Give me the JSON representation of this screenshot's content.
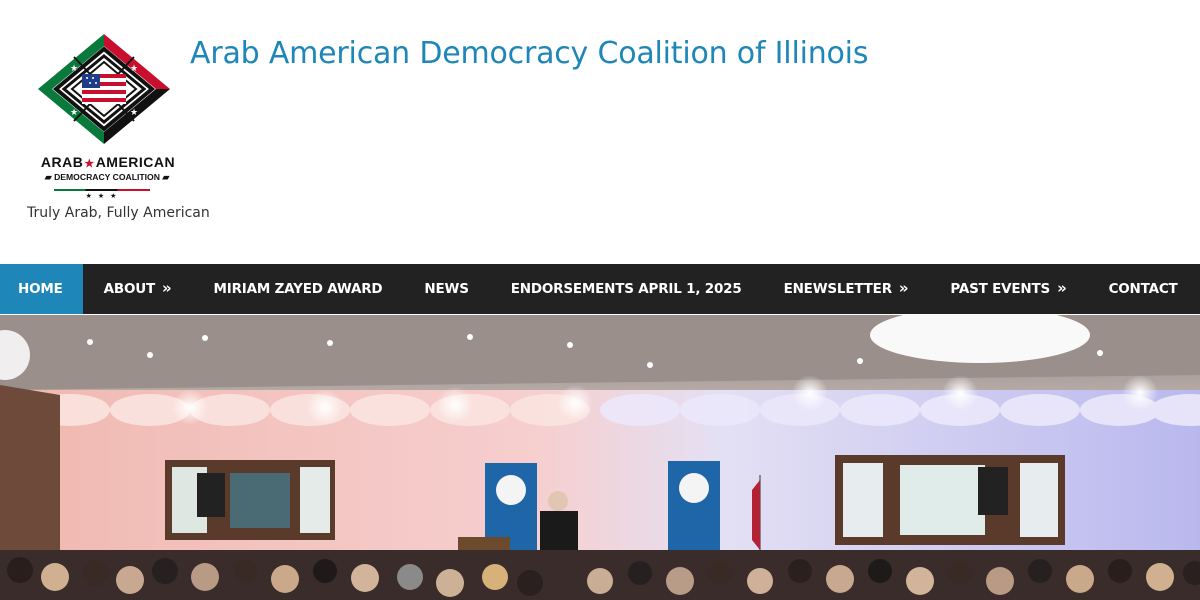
{
  "header": {
    "site_title": "Arab American Democracy Coalition of Illinois",
    "tagline": "Truly Arab, Fully American",
    "logo": {
      "line1_left": "ARAB",
      "line1_star": "★",
      "line1_right": "AMERICAN",
      "line2": "DEMOCRACY COALITION",
      "stars": "★ ★ ★",
      "icon": "diamond-flag-logo-icon"
    }
  },
  "nav": {
    "items": [
      {
        "label": "HOME",
        "active": true,
        "has_submenu": false
      },
      {
        "label": "ABOUT",
        "active": false,
        "has_submenu": true
      },
      {
        "label": "MIRIAM ZAYED AWARD",
        "active": false,
        "has_submenu": false
      },
      {
        "label": "NEWS",
        "active": false,
        "has_submenu": false
      },
      {
        "label": "ENDORSEMENTS APRIL 1, 2025",
        "active": false,
        "has_submenu": false
      },
      {
        "label": "ENEWSLETTER",
        "active": false,
        "has_submenu": true
      },
      {
        "label": "PAST EVENTS",
        "active": false,
        "has_submenu": true
      },
      {
        "label": "CONTACT",
        "active": false,
        "has_submenu": false
      }
    ],
    "submenu_glyph": "»"
  },
  "colors": {
    "accent": "#1e86b8",
    "nav_bg": "#222222",
    "nav_text": "#ffffff",
    "flag_green": "#0a7a3c",
    "flag_red": "#c8102e"
  },
  "hero": {
    "image": "banquet-hall-event-photo"
  }
}
